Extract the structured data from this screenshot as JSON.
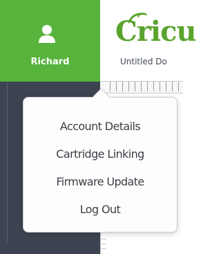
{
  "user": {
    "name": "Richard",
    "icon": "user-icon"
  },
  "app": {
    "logo_text": "Cricu",
    "document_title": "Untitled Do"
  },
  "colors": {
    "header_green": "#58b33d",
    "sidebar_dark": "#3d4350",
    "logo_green": "#5aa42e"
  },
  "menu": {
    "items": [
      {
        "label": "Account Details"
      },
      {
        "label": "Cartridge Linking"
      },
      {
        "label": "Firmware Update"
      },
      {
        "label": "Log Out"
      }
    ]
  }
}
